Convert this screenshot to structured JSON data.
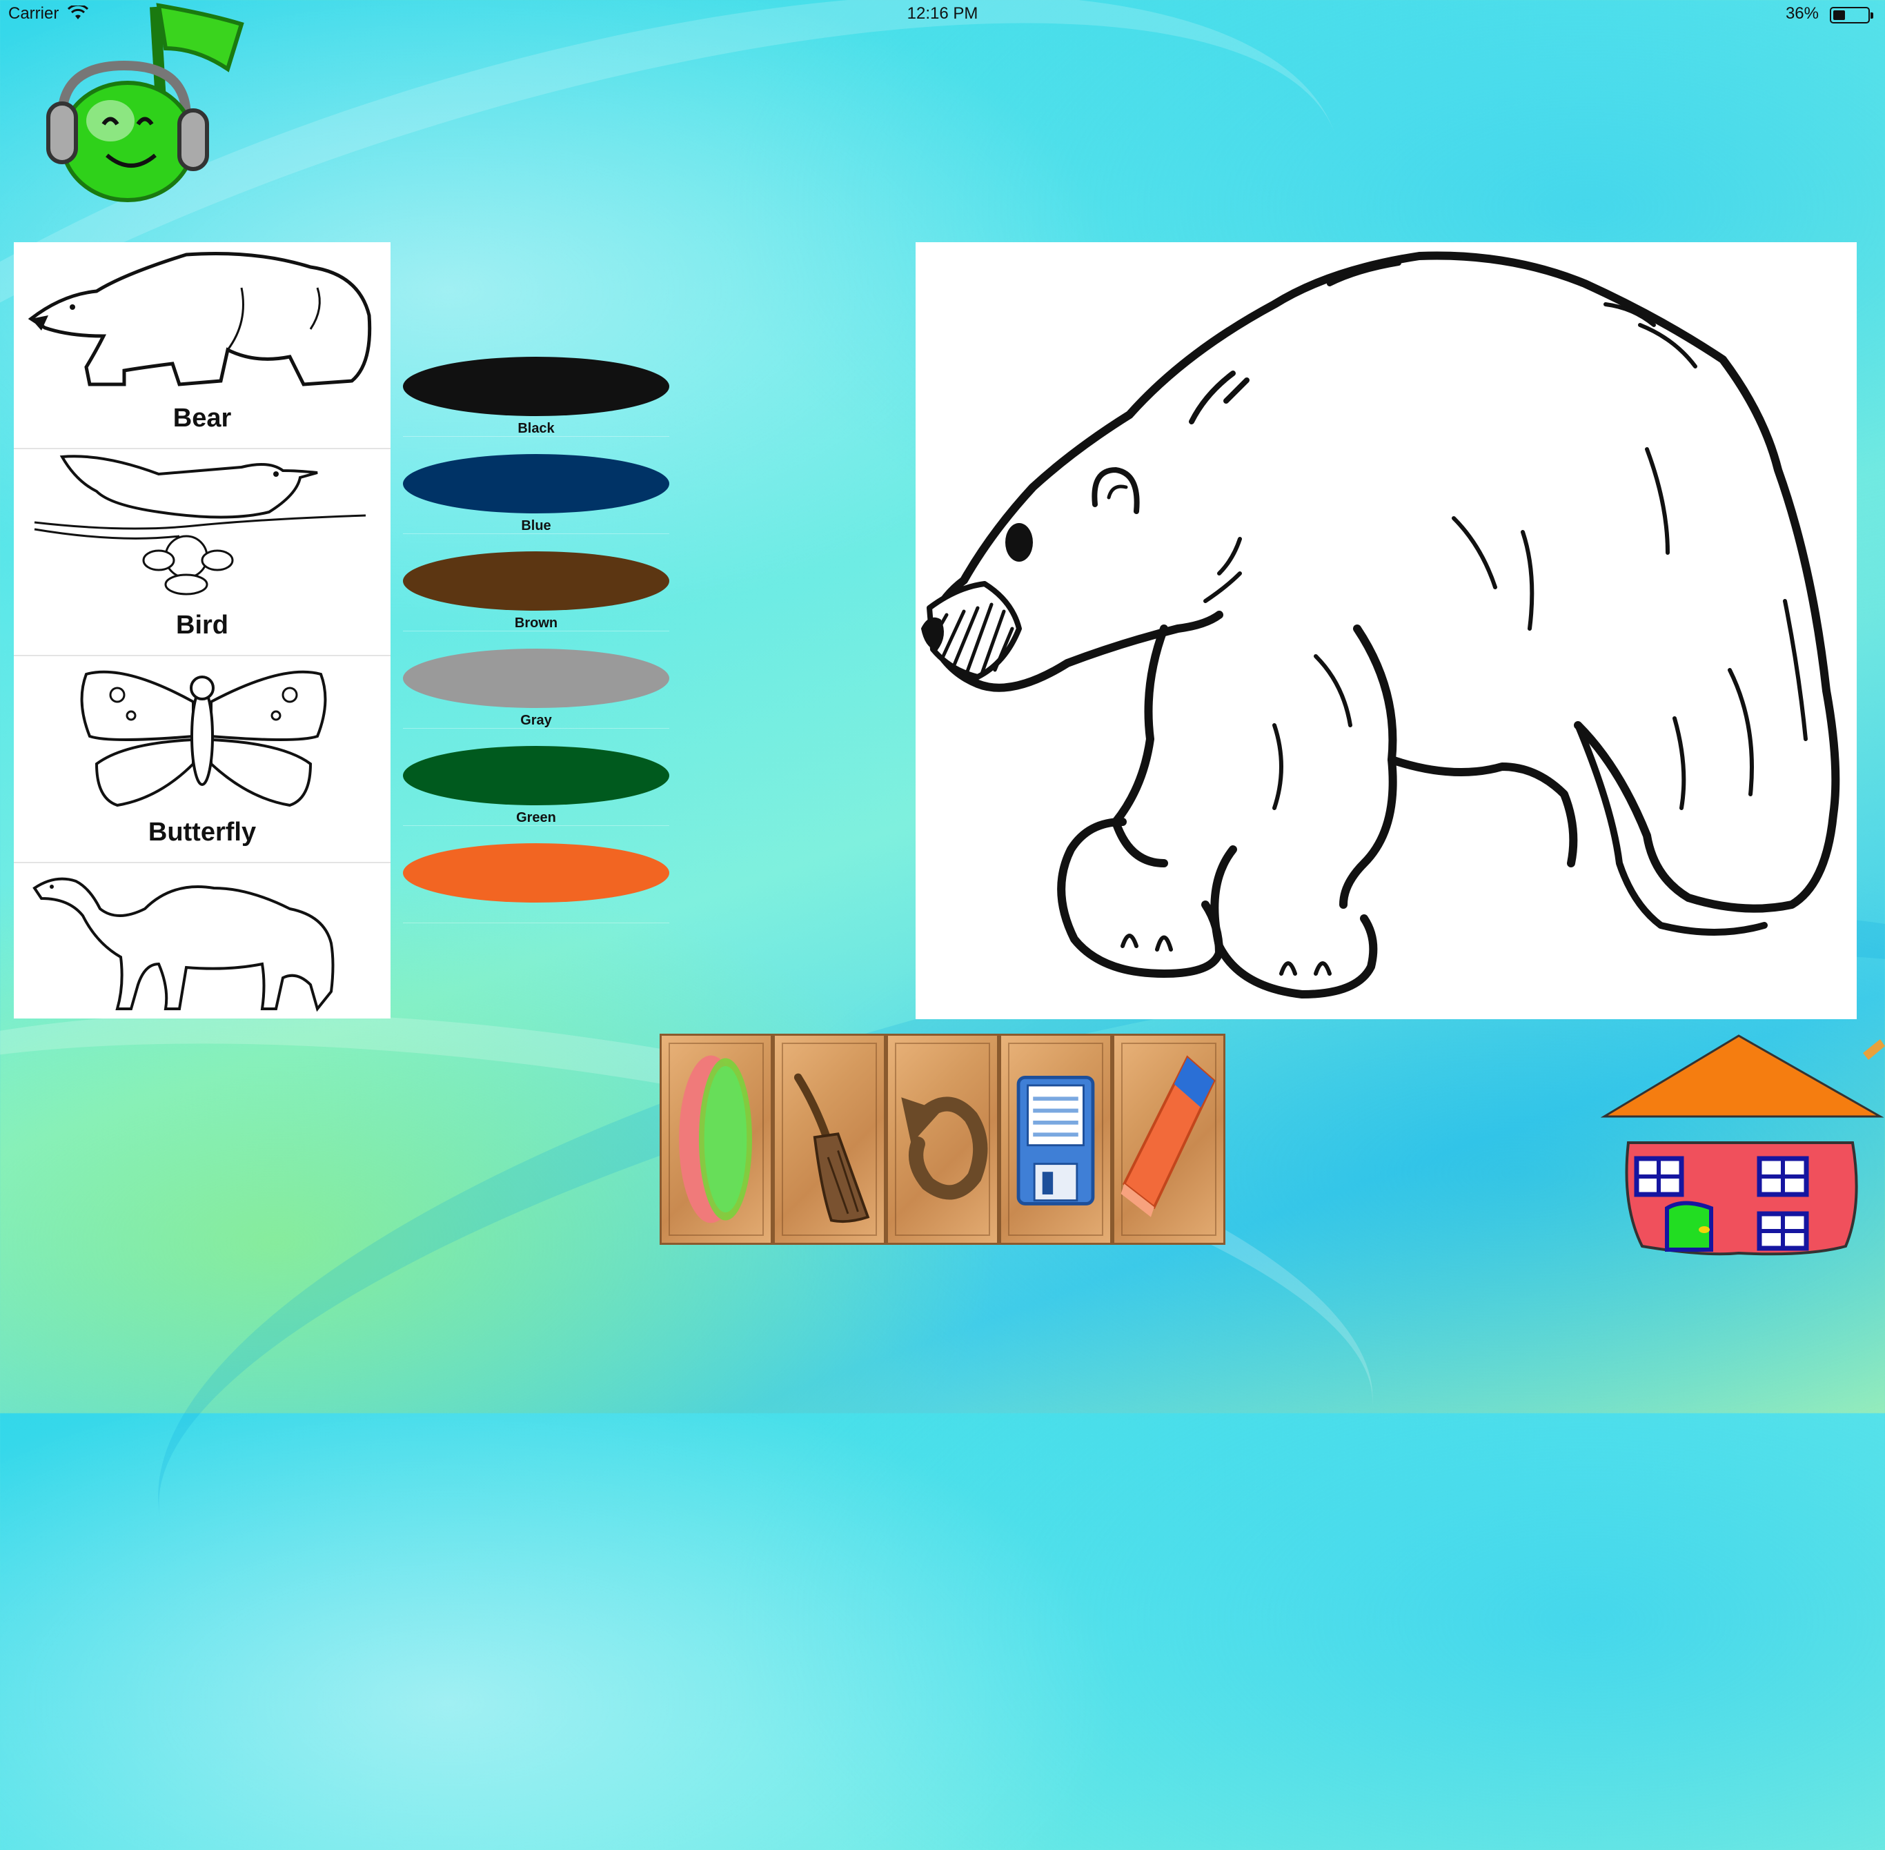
{
  "status_bar": {
    "carrier": "Carrier",
    "time": "12:16 PM",
    "battery": "36%",
    "battery_level": 0.36
  },
  "pictures": [
    {
      "label": "Bear",
      "icon": "bear-thumbnail"
    },
    {
      "label": "Bird",
      "icon": "bird-thumbnail"
    },
    {
      "label": "Butterfly",
      "icon": "butterfly-thumbnail"
    },
    {
      "label": "",
      "icon": "camel-thumbnail"
    }
  ],
  "colors": [
    {
      "label": "Black",
      "hex": "#111111"
    },
    {
      "label": "Blue",
      "hex": "#003366"
    },
    {
      "label": "Brown",
      "hex": "#5c3612"
    },
    {
      "label": "Gray",
      "hex": "#9a9a9a"
    },
    {
      "label": "Green",
      "hex": "#005a1e"
    },
    {
      "label": "",
      "hex": "#f26522"
    }
  ],
  "canvas": {
    "image": "polar-bear-outline",
    "background": "#ffffff"
  },
  "toolbar": [
    {
      "name": "brush-size-tool",
      "icon": "brush-size-icon"
    },
    {
      "name": "paint-brush-tool",
      "icon": "paint-brush-icon"
    },
    {
      "name": "undo-tool",
      "icon": "undo-icon"
    },
    {
      "name": "save-tool",
      "icon": "save-disk-icon"
    },
    {
      "name": "eraser-tool",
      "icon": "eraser-icon"
    }
  ],
  "icons": {
    "top_left": "music-note-headphones-icon",
    "bottom_right": "home-icon"
  }
}
